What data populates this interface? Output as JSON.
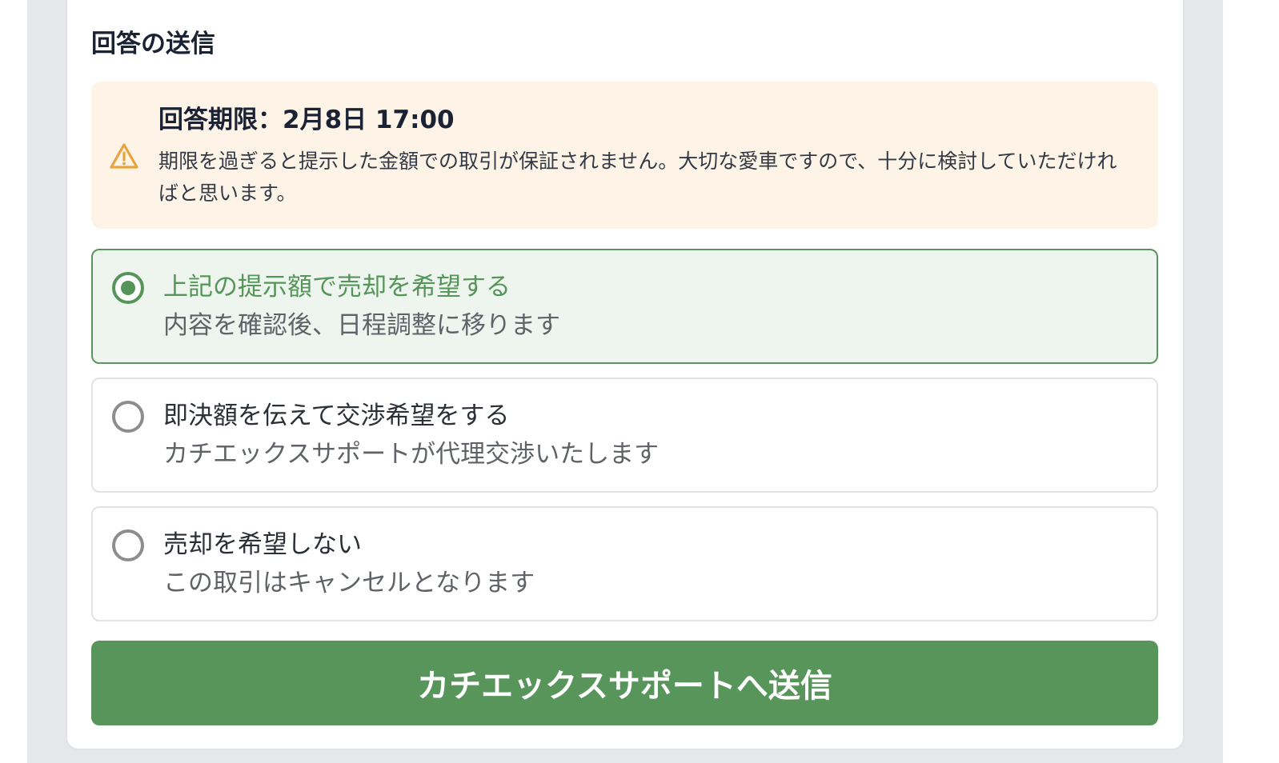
{
  "section": {
    "title": "回答の送信"
  },
  "notice": {
    "icon": "warning-triangle-icon",
    "accent_color": "#e8a33d",
    "deadline": "回答期限：2月8日 17:00",
    "body": "期限を過ぎると提示した金額での取引が保証されません。大切な愛車ですので、十分に検討していただければと思います。"
  },
  "options": [
    {
      "title": "上記の提示額で売却を希望する",
      "subtitle": "内容を確認後、日程調整に移ります",
      "selected": true
    },
    {
      "title": "即決額を伝えて交渉希望をする",
      "subtitle": "カチエックスサポートが代理交渉いたします",
      "selected": false
    },
    {
      "title": "売却を希望しない",
      "subtitle": "この取引はキャンセルとなります",
      "selected": false
    }
  ],
  "submit": {
    "label": "カチエックスサポートへ送信"
  },
  "colors": {
    "primary_green": "#57955b",
    "notice_bg": "#fdf4e7",
    "selected_bg": "#eef5ee"
  }
}
